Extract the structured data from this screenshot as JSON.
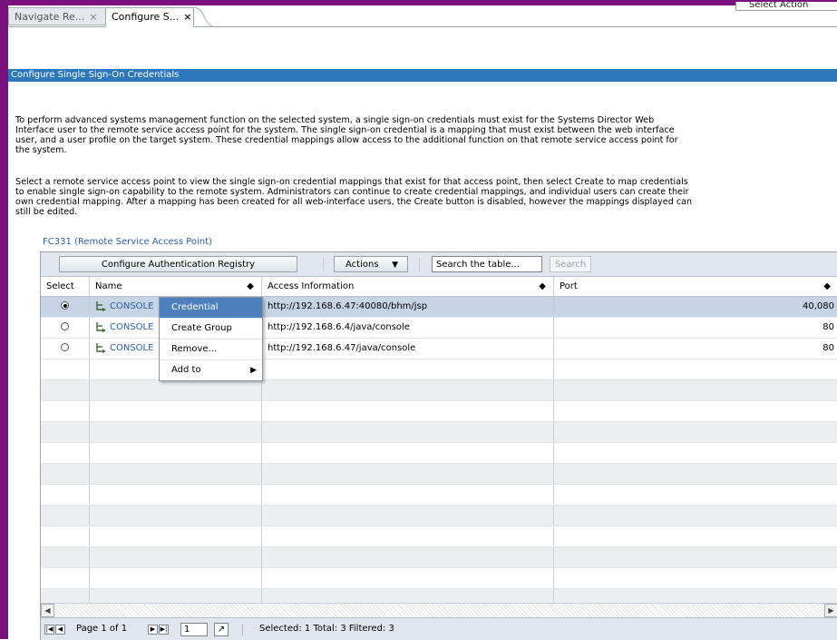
{
  "tabs": [
    {
      "label": "Navigate Re...",
      "close": "×"
    },
    {
      "label": "Configure S...",
      "close": "×"
    }
  ],
  "select_action_label": "Select Action",
  "page_title": "Configure Single Sign-On Credentials",
  "paragraph1": [
    "To perform advanced systems management function on the selected system, a single sign-on credentials must exist for the Systems Director Web",
    "Interface user to the remote service access point for the system. The single sign-on credential is a mapping that must exist between the web interface",
    "user, and a user profile on the target system. These credential mappings allow access to the additional function on that remote service access point for",
    "the system."
  ],
  "paragraph2": [
    "Select a remote service access point to view the single sign-on credential mappings that exist for that access point, then select Create to map credentials",
    "to enable single sign-on capability to the remote system. Administrators can continue to create credential mappings, and individual users can create their",
    "own credential mapping. After a mapping has been created for all web-interface users, the Create button is disabled, however the mappings displayed can",
    "still be edited."
  ],
  "access_point_title": "FC331 (Remote Service Access Point)",
  "toolbar": {
    "configure_label": "Configure Authentication Registry",
    "actions_label": "Actions",
    "actions_caret": "▼",
    "search_value": "Search the table...",
    "search_button": "Search"
  },
  "columns": {
    "select": "Select",
    "name": "Name",
    "access": "Access Information",
    "port": "Port",
    "sort_glyph": "◆"
  },
  "rows": [
    {
      "selected": true,
      "name": "CONSOLE",
      "access": "http://192.168.6.47:40080/bhm/jsp",
      "port": "40,080"
    },
    {
      "selected": false,
      "name": "CONSOLE",
      "access": "http://192.168.6.4/java/console",
      "port": "80"
    },
    {
      "selected": false,
      "name": "CONSOLE",
      "access": "http://192.168.6.47/java/console",
      "port": "80"
    }
  ],
  "context_menu": [
    {
      "label": "Credential",
      "highlighted": true,
      "submenu": false
    },
    {
      "label": "Create Group",
      "highlighted": false,
      "submenu": false
    },
    {
      "label": "Remove...",
      "highlighted": false,
      "submenu": false
    },
    {
      "label": "Add to",
      "highlighted": false,
      "submenu": true
    }
  ],
  "footer": {
    "page_label": "Page 1 of 1",
    "page_input": "1",
    "go_glyph": "↗",
    "stats": "Selected: 1   Total: 3   Filtered: 3"
  },
  "colors": {
    "frame": "#7a0f7e",
    "title_bar": "#2d78bd",
    "selected_row": "#c6d4e6",
    "menu_highlight": "#4d7fbd",
    "link": "#2a5fa8"
  }
}
